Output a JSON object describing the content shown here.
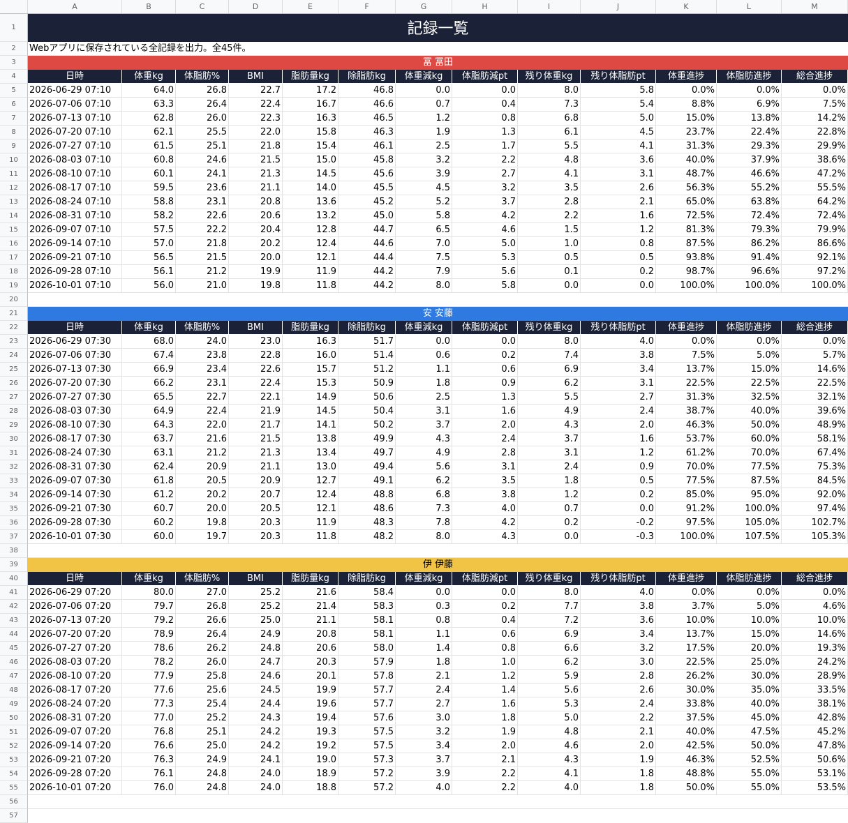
{
  "column_letters": [
    "A",
    "B",
    "C",
    "D",
    "E",
    "F",
    "G",
    "H",
    "I",
    "J",
    "K",
    "L",
    "M"
  ],
  "title": "記録一覧",
  "description": "Webアプリに保存されている全記録を出力。全45件。",
  "headers": [
    "日時",
    "体重kg",
    "体脂肪%",
    "BMI",
    "脂肪量kg",
    "除脂肪kg",
    "体重減kg",
    "体脂肪減pt",
    "残り体重kg",
    "残り体脂肪pt",
    "体重進捗",
    "体脂肪進捗",
    "総合進捗"
  ],
  "colors": {
    "dark_navy": "#1b2238",
    "red": "#de4a43",
    "blue": "#2f7ae0",
    "yellow": "#f2c446"
  },
  "sections": [
    {
      "name": "冨 冨田",
      "color": "#de4a43",
      "text_color": "#ffffff",
      "rows": [
        [
          "2026-06-29 07:10",
          "64.0",
          "26.8",
          "22.7",
          "17.2",
          "46.8",
          "0.0",
          "0.0",
          "8.0",
          "5.8",
          "0.0%",
          "0.0%",
          "0.0%"
        ],
        [
          "2026-07-06 07:10",
          "63.3",
          "26.4",
          "22.4",
          "16.7",
          "46.6",
          "0.7",
          "0.4",
          "7.3",
          "5.4",
          "8.8%",
          "6.9%",
          "7.5%"
        ],
        [
          "2026-07-13 07:10",
          "62.8",
          "26.0",
          "22.3",
          "16.3",
          "46.5",
          "1.2",
          "0.8",
          "6.8",
          "5.0",
          "15.0%",
          "13.8%",
          "14.2%"
        ],
        [
          "2026-07-20 07:10",
          "62.1",
          "25.5",
          "22.0",
          "15.8",
          "46.3",
          "1.9",
          "1.3",
          "6.1",
          "4.5",
          "23.7%",
          "22.4%",
          "22.8%"
        ],
        [
          "2026-07-27 07:10",
          "61.5",
          "25.1",
          "21.8",
          "15.4",
          "46.1",
          "2.5",
          "1.7",
          "5.5",
          "4.1",
          "31.3%",
          "29.3%",
          "29.9%"
        ],
        [
          "2026-08-03 07:10",
          "60.8",
          "24.6",
          "21.5",
          "15.0",
          "45.8",
          "3.2",
          "2.2",
          "4.8",
          "3.6",
          "40.0%",
          "37.9%",
          "38.6%"
        ],
        [
          "2026-08-10 07:10",
          "60.1",
          "24.1",
          "21.3",
          "14.5",
          "45.6",
          "3.9",
          "2.7",
          "4.1",
          "3.1",
          "48.7%",
          "46.6%",
          "47.2%"
        ],
        [
          "2026-08-17 07:10",
          "59.5",
          "23.6",
          "21.1",
          "14.0",
          "45.5",
          "4.5",
          "3.2",
          "3.5",
          "2.6",
          "56.3%",
          "55.2%",
          "55.5%"
        ],
        [
          "2026-08-24 07:10",
          "58.8",
          "23.1",
          "20.8",
          "13.6",
          "45.2",
          "5.2",
          "3.7",
          "2.8",
          "2.1",
          "65.0%",
          "63.8%",
          "64.2%"
        ],
        [
          "2026-08-31 07:10",
          "58.2",
          "22.6",
          "20.6",
          "13.2",
          "45.0",
          "5.8",
          "4.2",
          "2.2",
          "1.6",
          "72.5%",
          "72.4%",
          "72.4%"
        ],
        [
          "2026-09-07 07:10",
          "57.5",
          "22.2",
          "20.4",
          "12.8",
          "44.7",
          "6.5",
          "4.6",
          "1.5",
          "1.2",
          "81.3%",
          "79.3%",
          "79.9%"
        ],
        [
          "2026-09-14 07:10",
          "57.0",
          "21.8",
          "20.2",
          "12.4",
          "44.6",
          "7.0",
          "5.0",
          "1.0",
          "0.8",
          "87.5%",
          "86.2%",
          "86.6%"
        ],
        [
          "2026-09-21 07:10",
          "56.5",
          "21.5",
          "20.0",
          "12.1",
          "44.4",
          "7.5",
          "5.3",
          "0.5",
          "0.5",
          "93.8%",
          "91.4%",
          "92.1%"
        ],
        [
          "2026-09-28 07:10",
          "56.1",
          "21.2",
          "19.9",
          "11.9",
          "44.2",
          "7.9",
          "5.6",
          "0.1",
          "0.2",
          "98.7%",
          "96.6%",
          "97.2%"
        ],
        [
          "2026-10-01 07:10",
          "56.0",
          "21.0",
          "19.8",
          "11.8",
          "44.2",
          "8.0",
          "5.8",
          "0.0",
          "0.0",
          "100.0%",
          "100.0%",
          "100.0%"
        ]
      ]
    },
    {
      "name": "安 安藤",
      "color": "#2f7ae0",
      "text_color": "#ffffff",
      "rows": [
        [
          "2026-06-29 07:30",
          "68.0",
          "24.0",
          "23.0",
          "16.3",
          "51.7",
          "0.0",
          "0.0",
          "8.0",
          "4.0",
          "0.0%",
          "0.0%",
          "0.0%"
        ],
        [
          "2026-07-06 07:30",
          "67.4",
          "23.8",
          "22.8",
          "16.0",
          "51.4",
          "0.6",
          "0.2",
          "7.4",
          "3.8",
          "7.5%",
          "5.0%",
          "5.7%"
        ],
        [
          "2026-07-13 07:30",
          "66.9",
          "23.4",
          "22.6",
          "15.7",
          "51.2",
          "1.1",
          "0.6",
          "6.9",
          "3.4",
          "13.7%",
          "15.0%",
          "14.6%"
        ],
        [
          "2026-07-20 07:30",
          "66.2",
          "23.1",
          "22.4",
          "15.3",
          "50.9",
          "1.8",
          "0.9",
          "6.2",
          "3.1",
          "22.5%",
          "22.5%",
          "22.5%"
        ],
        [
          "2026-07-27 07:30",
          "65.5",
          "22.7",
          "22.1",
          "14.9",
          "50.6",
          "2.5",
          "1.3",
          "5.5",
          "2.7",
          "31.3%",
          "32.5%",
          "32.1%"
        ],
        [
          "2026-08-03 07:30",
          "64.9",
          "22.4",
          "21.9",
          "14.5",
          "50.4",
          "3.1",
          "1.6",
          "4.9",
          "2.4",
          "38.7%",
          "40.0%",
          "39.6%"
        ],
        [
          "2026-08-10 07:30",
          "64.3",
          "22.0",
          "21.7",
          "14.1",
          "50.2",
          "3.7",
          "2.0",
          "4.3",
          "2.0",
          "46.3%",
          "50.0%",
          "48.9%"
        ],
        [
          "2026-08-17 07:30",
          "63.7",
          "21.6",
          "21.5",
          "13.8",
          "49.9",
          "4.3",
          "2.4",
          "3.7",
          "1.6",
          "53.7%",
          "60.0%",
          "58.1%"
        ],
        [
          "2026-08-24 07:30",
          "63.1",
          "21.2",
          "21.3",
          "13.4",
          "49.7",
          "4.9",
          "2.8",
          "3.1",
          "1.2",
          "61.2%",
          "70.0%",
          "67.4%"
        ],
        [
          "2026-08-31 07:30",
          "62.4",
          "20.9",
          "21.1",
          "13.0",
          "49.4",
          "5.6",
          "3.1",
          "2.4",
          "0.9",
          "70.0%",
          "77.5%",
          "75.3%"
        ],
        [
          "2026-09-07 07:30",
          "61.8",
          "20.5",
          "20.9",
          "12.7",
          "49.1",
          "6.2",
          "3.5",
          "1.8",
          "0.5",
          "77.5%",
          "87.5%",
          "84.5%"
        ],
        [
          "2026-09-14 07:30",
          "61.2",
          "20.2",
          "20.7",
          "12.4",
          "48.8",
          "6.8",
          "3.8",
          "1.2",
          "0.2",
          "85.0%",
          "95.0%",
          "92.0%"
        ],
        [
          "2026-09-21 07:30",
          "60.7",
          "20.0",
          "20.5",
          "12.1",
          "48.6",
          "7.3",
          "4.0",
          "0.7",
          "0.0",
          "91.2%",
          "100.0%",
          "97.4%"
        ],
        [
          "2026-09-28 07:30",
          "60.2",
          "19.8",
          "20.3",
          "11.9",
          "48.3",
          "7.8",
          "4.2",
          "0.2",
          "-0.2",
          "97.5%",
          "105.0%",
          "102.7%"
        ],
        [
          "2026-10-01 07:30",
          "60.0",
          "19.7",
          "20.3",
          "11.8",
          "48.2",
          "8.0",
          "4.3",
          "0.0",
          "-0.3",
          "100.0%",
          "107.5%",
          "105.3%"
        ]
      ]
    },
    {
      "name": "伊 伊藤",
      "color": "#f2c446",
      "text_color": "#000000",
      "rows": [
        [
          "2026-06-29 07:20",
          "80.0",
          "27.0",
          "25.2",
          "21.6",
          "58.4",
          "0.0",
          "0.0",
          "8.0",
          "4.0",
          "0.0%",
          "0.0%",
          "0.0%"
        ],
        [
          "2026-07-06 07:20",
          "79.7",
          "26.8",
          "25.2",
          "21.4",
          "58.3",
          "0.3",
          "0.2",
          "7.7",
          "3.8",
          "3.7%",
          "5.0%",
          "4.6%"
        ],
        [
          "2026-07-13 07:20",
          "79.2",
          "26.6",
          "25.0",
          "21.1",
          "58.1",
          "0.8",
          "0.4",
          "7.2",
          "3.6",
          "10.0%",
          "10.0%",
          "10.0%"
        ],
        [
          "2026-07-20 07:20",
          "78.9",
          "26.4",
          "24.9",
          "20.8",
          "58.1",
          "1.1",
          "0.6",
          "6.9",
          "3.4",
          "13.7%",
          "15.0%",
          "14.6%"
        ],
        [
          "2026-07-27 07:20",
          "78.6",
          "26.2",
          "24.8",
          "20.6",
          "58.0",
          "1.4",
          "0.8",
          "6.6",
          "3.2",
          "17.5%",
          "20.0%",
          "19.3%"
        ],
        [
          "2026-08-03 07:20",
          "78.2",
          "26.0",
          "24.7",
          "20.3",
          "57.9",
          "1.8",
          "1.0",
          "6.2",
          "3.0",
          "22.5%",
          "25.0%",
          "24.2%"
        ],
        [
          "2026-08-10 07:20",
          "77.9",
          "25.8",
          "24.6",
          "20.1",
          "57.8",
          "2.1",
          "1.2",
          "5.9",
          "2.8",
          "26.2%",
          "30.0%",
          "28.9%"
        ],
        [
          "2026-08-17 07:20",
          "77.6",
          "25.6",
          "24.5",
          "19.9",
          "57.7",
          "2.4",
          "1.4",
          "5.6",
          "2.6",
          "30.0%",
          "35.0%",
          "33.5%"
        ],
        [
          "2026-08-24 07:20",
          "77.3",
          "25.4",
          "24.4",
          "19.6",
          "57.7",
          "2.7",
          "1.6",
          "5.3",
          "2.4",
          "33.8%",
          "40.0%",
          "38.1%"
        ],
        [
          "2026-08-31 07:20",
          "77.0",
          "25.2",
          "24.3",
          "19.4",
          "57.6",
          "3.0",
          "1.8",
          "5.0",
          "2.2",
          "37.5%",
          "45.0%",
          "42.8%"
        ],
        [
          "2026-09-07 07:20",
          "76.8",
          "25.1",
          "24.2",
          "19.3",
          "57.5",
          "3.2",
          "1.9",
          "4.8",
          "2.1",
          "40.0%",
          "47.5%",
          "45.2%"
        ],
        [
          "2026-09-14 07:20",
          "76.6",
          "25.0",
          "24.2",
          "19.2",
          "57.5",
          "3.4",
          "2.0",
          "4.6",
          "2.0",
          "42.5%",
          "50.0%",
          "47.8%"
        ],
        [
          "2026-09-21 07:20",
          "76.3",
          "24.9",
          "24.1",
          "19.0",
          "57.3",
          "3.7",
          "2.1",
          "4.3",
          "1.9",
          "46.3%",
          "52.5%",
          "50.6%"
        ],
        [
          "2026-09-28 07:20",
          "76.1",
          "24.8",
          "24.0",
          "18.9",
          "57.2",
          "3.9",
          "2.2",
          "4.1",
          "1.8",
          "48.8%",
          "55.0%",
          "53.1%"
        ],
        [
          "2026-10-01 07:20",
          "76.0",
          "24.8",
          "24.0",
          "18.8",
          "57.2",
          "4.0",
          "2.2",
          "4.0",
          "1.8",
          "50.0%",
          "55.0%",
          "53.5%"
        ]
      ]
    }
  ]
}
